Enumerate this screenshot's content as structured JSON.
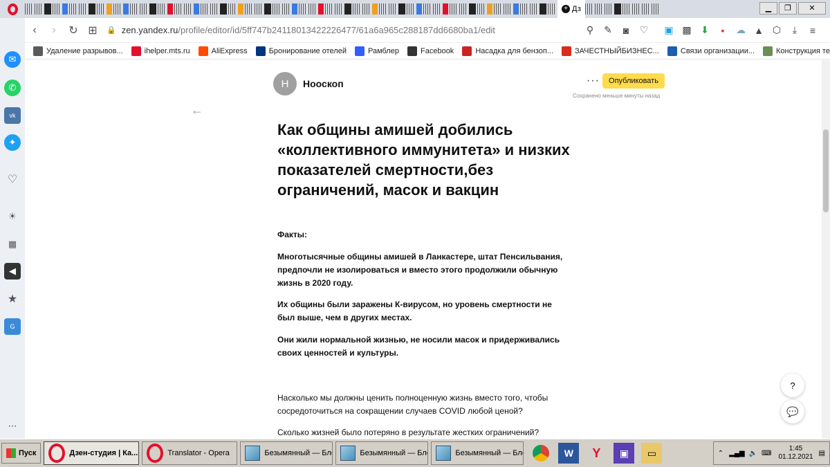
{
  "browser": {
    "active_tab_label": "Дз",
    "url_host": "zen.yandex.ru",
    "url_path": "/profile/editor/id/5ff747b24118013422226477/61a6a965c288187dd6680ba1/edit"
  },
  "bookmarks": [
    {
      "label": "Удаление разрывов...",
      "color": "#5a5a5a"
    },
    {
      "label": "ihelper.mts.ru",
      "color": "#e3102c"
    },
    {
      "label": "AliExpress",
      "color": "#ff4a00"
    },
    {
      "label": "Бронирование отелей",
      "color": "#003580"
    },
    {
      "label": "Рамблер",
      "color": "#315efb"
    },
    {
      "label": "Facebook",
      "color": "#333333"
    },
    {
      "label": "Насадка для бензоп...",
      "color": "#cc2222"
    },
    {
      "label": "ЗАЧЕСТНЫЙБИЗНЕС...",
      "color": "#d92a1c"
    },
    {
      "label": "Связи организации...",
      "color": "#1b5fae"
    },
    {
      "label": "Конструкция теплог...",
      "color": "#6a8f55"
    }
  ],
  "editor": {
    "avatar_letter": "Н",
    "channel_name": "Нооскоп",
    "publish_label": "Опубликовать",
    "saved_note": "Сохранено меньше минуты назад",
    "title": "Как общины амишей добились «коллективного иммунитета» и низких показателей смертности,без ограничений, масок и вакцин",
    "facts_label": "Факты:",
    "fact1": "Многотысячные общины амишей в Ланкастере, штат Пенсильвания, предпочли не изолироваться и вместо этого продолжили обычную жизнь в 2020 году.",
    "fact2": "Их общины были заражены К-вирусом, но уровень смертности не был выше, чем в других местах.",
    "fact3": "Они жили нормальной жизнью, не носили масок и придерживались своих ценностей и культуры.",
    "para1": "Насколько мы должны ценить полноценную жизнь вместо того, чтобы сосредоточиться на сокращении случаев COVID любой ценой?",
    "para2": "Сколько жизней было потеряно в результате жестких ограничений?",
    "help_label": "?"
  },
  "taskbar": {
    "start_label": "Пуск",
    "tasks": [
      "Дзен-студия | Ка...",
      "Translator - Opera",
      "Безымянный — Блок...",
      "Безымянный — Блок...",
      "Безымянный — Блок..."
    ],
    "time": "1:45",
    "date": "01.12.2021"
  },
  "colors": {
    "publish": "#ffdb4d",
    "opera_red": "#e3102c"
  }
}
